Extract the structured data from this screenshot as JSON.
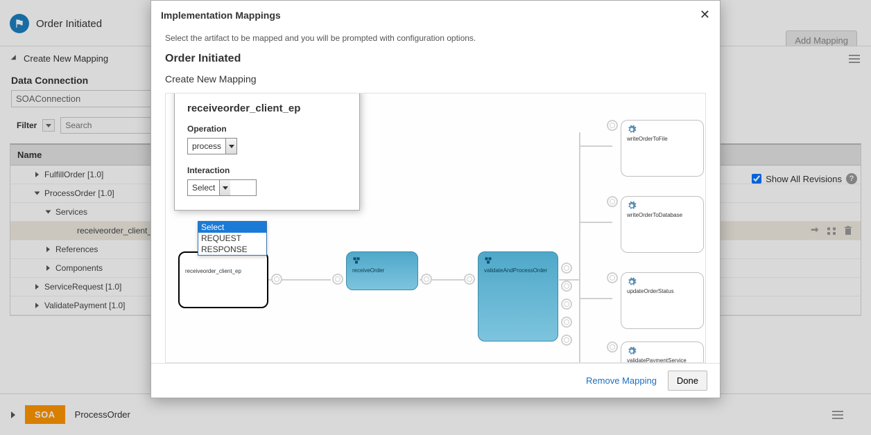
{
  "background": {
    "header_title": "Order Initiated",
    "add_mapping_btn": "Add Mapping",
    "section_title": "Create New Mapping",
    "data_connection_label": "Data Connection",
    "data_connection_value": "SOAConnection",
    "filter_label": "Filter",
    "search_placeholder": "Search",
    "show_all_revisions": "Show All Revisions",
    "tree": {
      "header": "Name",
      "rows": {
        "fulfillorder": "FulfillOrder [1.0]",
        "processorder": "ProcessOrder [1.0]",
        "services": "Services",
        "receiveorder": "receiveorder_client_ep",
        "references": "References",
        "components": "Components",
        "servicerequest": "ServiceRequest [1.0]",
        "validatepayment": "ValidatePayment [1.0]"
      }
    },
    "footer": {
      "badge": "SOA",
      "text": "ProcessOrder"
    }
  },
  "modal": {
    "title": "Implementation Mappings",
    "subtext": "Select the artifact to be mapped and you will be prompted with configuration options.",
    "h2": "Order Initiated",
    "h3": "Create New Mapping",
    "popover": {
      "title": "receiveorder_client_ep",
      "operation_label": "Operation",
      "operation_value": "process",
      "interaction_label": "Interaction",
      "interaction_value": "Select",
      "interaction_options": [
        "Select",
        "REQUEST",
        "RESPONSE"
      ]
    },
    "nodes": {
      "receiveorder_client": "receiveorder_client_ep",
      "receiveOrder": "receiveOrder",
      "validateAndProcess": "validateAndProcessOrder",
      "writeOrderToFile": "writeOrderToFile",
      "writeOrderToDatabase": "writeOrderToDatabase",
      "updateOrderStatus": "updateOrderStatus",
      "validatePaymentService": "validatePaymentService"
    },
    "footer": {
      "remove": "Remove Mapping",
      "done": "Done"
    }
  }
}
